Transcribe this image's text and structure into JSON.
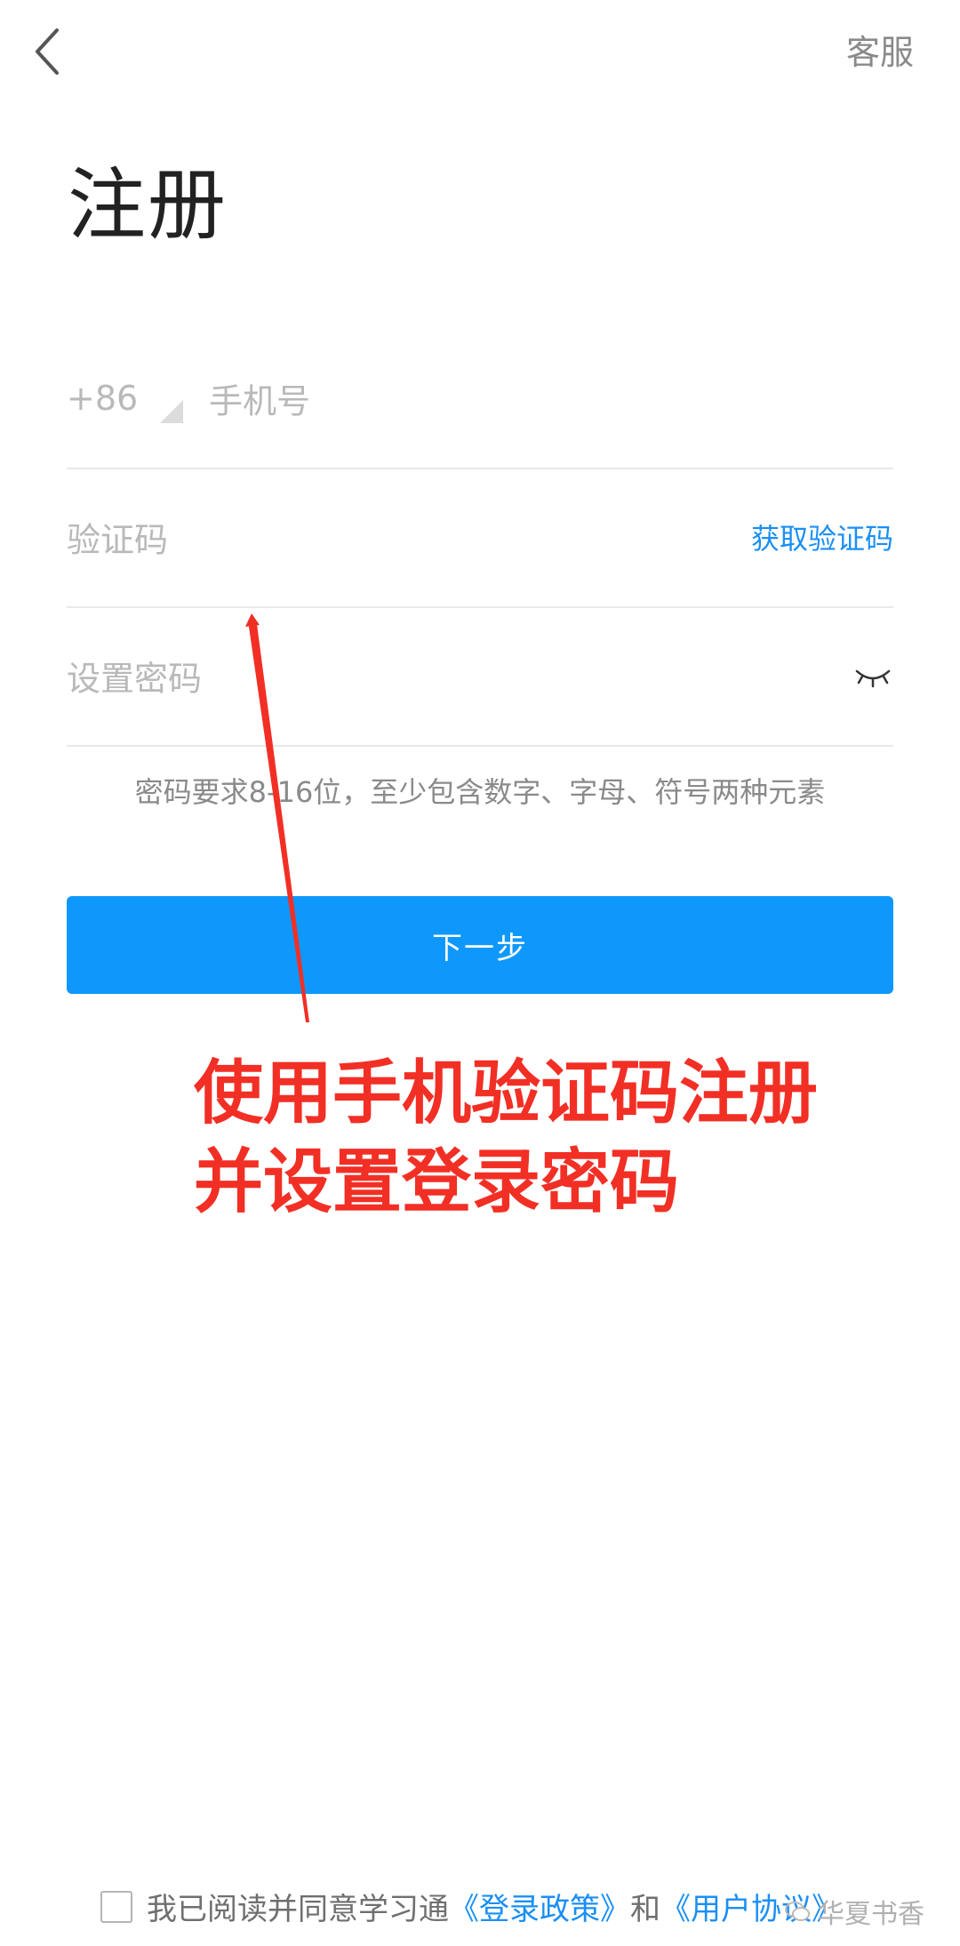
{
  "header": {
    "back_label": "",
    "service_label": "客服",
    "title": "注册"
  },
  "form": {
    "country_code": "+86",
    "phone_placeholder": "手机号",
    "code_placeholder": "验证码",
    "get_code_label": "获取验证码",
    "password_placeholder": "设置密码",
    "password_hint": "密码要求8-16位，至少包含数字、字母、符号两种元素",
    "next_label": "下一步"
  },
  "annotation": {
    "line1": "使用手机验证码注册",
    "line2": "并设置登录密码",
    "color": "#f22f25"
  },
  "agreement": {
    "text": "我已阅读并同意学习通",
    "link1": "《登录政策》",
    "and": "和",
    "link2": "《用户协议》"
  },
  "watermark": {
    "text": "华夏书香"
  },
  "colors": {
    "accent": "#0e98fb",
    "link": "#1a8ff5"
  },
  "icons": {
    "back": "chevron-left-icon",
    "eye": "eye-closed-icon",
    "dropdown": "triangle-icon",
    "watermark": "wechat-icon"
  }
}
